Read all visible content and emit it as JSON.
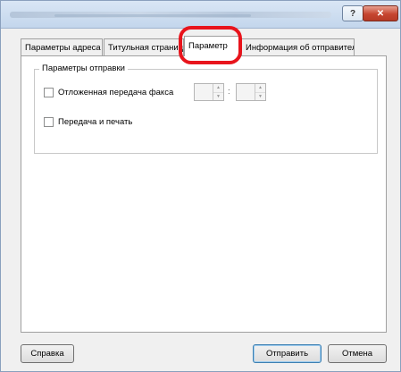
{
  "titlebar": {
    "help_label": "?",
    "close_label": "✕"
  },
  "tabs": [
    {
      "label": "Параметры адреса"
    },
    {
      "label": "Титульная страниц"
    },
    {
      "label": "Параметр"
    },
    {
      "label": "Информация об отправителе"
    }
  ],
  "group": {
    "title": "Параметры отправки",
    "delayed_fax_label": "Отложенная передача факса",
    "delayed_fax_checked": false,
    "hour_value": "",
    "minute_value": "",
    "time_separator": ":",
    "send_and_print_label": "Передача и печать",
    "send_and_print_checked": false
  },
  "buttons": {
    "help": "Справка",
    "send": "Отправить",
    "cancel": "Отмена"
  },
  "annotation_color": "#e8141c"
}
